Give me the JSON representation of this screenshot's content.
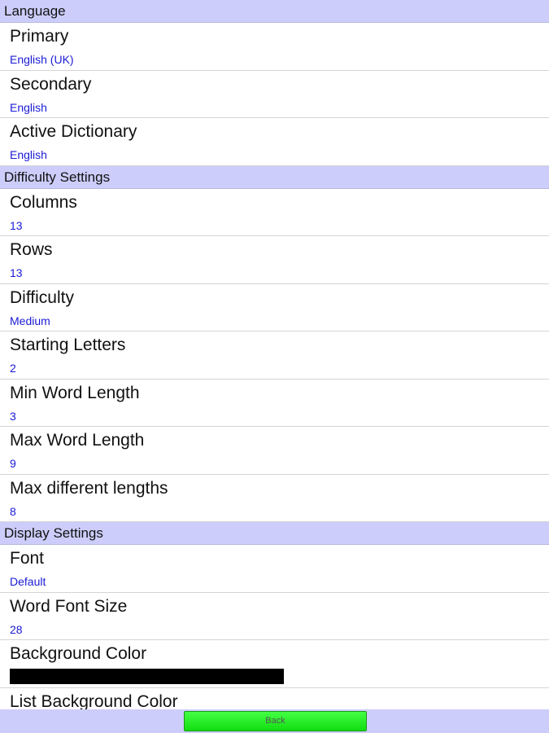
{
  "sections": [
    {
      "header": "Language",
      "items": [
        {
          "title": "Primary",
          "value": "English (UK)"
        },
        {
          "title": "Secondary",
          "value": "English"
        },
        {
          "title": "Active Dictionary",
          "value": "English"
        }
      ]
    },
    {
      "header": "Difficulty Settings",
      "items": [
        {
          "title": "Columns",
          "value": "13"
        },
        {
          "title": "Rows",
          "value": "13"
        },
        {
          "title": "Difficulty",
          "value": "Medium"
        },
        {
          "title": "Starting Letters",
          "value": "2"
        },
        {
          "title": "Min Word Length",
          "value": "3"
        },
        {
          "title": "Max Word Length",
          "value": "9"
        },
        {
          "title": "Max different lengths",
          "value": "8"
        }
      ]
    },
    {
      "header": "Display Settings",
      "items": [
        {
          "title": "Font",
          "value": "Default"
        },
        {
          "title": "Word Font Size",
          "value": "28"
        },
        {
          "title": "Background Color",
          "color": "#000000"
        },
        {
          "title": "List Background Color"
        }
      ]
    }
  ],
  "footer": {
    "back_label": "Back"
  },
  "colors": {
    "header_background": "#cccdfa",
    "value_text": "#1a1ad6",
    "back_button": "#22ee22"
  }
}
